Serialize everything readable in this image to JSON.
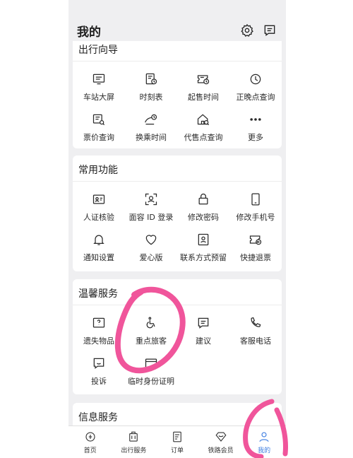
{
  "header": {
    "title": "我的",
    "settings_icon": "gear-icon",
    "message_icon": "message-icon"
  },
  "sections": [
    {
      "title": "出行向导",
      "items": [
        {
          "label": "车站大屏",
          "icon": "screen-icon"
        },
        {
          "label": "时刻表",
          "icon": "timetable-icon"
        },
        {
          "label": "起售时间",
          "icon": "ticket-clock-icon"
        },
        {
          "label": "正晚点查询",
          "icon": "clock-icon"
        },
        {
          "label": "票价查询",
          "icon": "price-search-icon"
        },
        {
          "label": "换乘时间",
          "icon": "transfer-time-icon"
        },
        {
          "label": "代售点查询",
          "icon": "agent-search-icon"
        },
        {
          "label": "更多",
          "icon": "more-icon"
        }
      ]
    },
    {
      "title": "常用功能",
      "items": [
        {
          "label": "人证核验",
          "icon": "id-card-icon"
        },
        {
          "label": "面容 ID 登录",
          "icon": "face-id-icon"
        },
        {
          "label": "修改密码",
          "icon": "lock-icon"
        },
        {
          "label": "修改手机号",
          "icon": "phone-icon"
        },
        {
          "label": "通知设置",
          "icon": "bell-icon"
        },
        {
          "label": "爱心版",
          "icon": "heart-icon"
        },
        {
          "label": "联系方式预留",
          "icon": "contact-icon"
        },
        {
          "label": "快捷退票",
          "icon": "refund-icon"
        }
      ]
    },
    {
      "title": "温馨服务",
      "items": [
        {
          "label": "遗失物品",
          "icon": "lost-item-icon"
        },
        {
          "label": "重点旅客",
          "icon": "wheelchair-icon"
        },
        {
          "label": "建议",
          "icon": "suggestion-icon"
        },
        {
          "label": "客服电话",
          "icon": "phone-call-icon"
        },
        {
          "label": "投诉",
          "icon": "complaint-icon"
        },
        {
          "label": "临时身份证明",
          "icon": "temp-id-icon"
        }
      ]
    },
    {
      "title": "信息服务"
    }
  ],
  "tabbar": [
    {
      "label": "首页",
      "icon": "home-icon"
    },
    {
      "label": "出行服务",
      "icon": "travel-icon"
    },
    {
      "label": "订单",
      "icon": "order-icon"
    },
    {
      "label": "铁路会员",
      "icon": "member-icon"
    },
    {
      "label": "我的",
      "icon": "user-icon",
      "active": true
    }
  ],
  "accent_color": "#3a7be0",
  "annotation_color": "#f0559b"
}
